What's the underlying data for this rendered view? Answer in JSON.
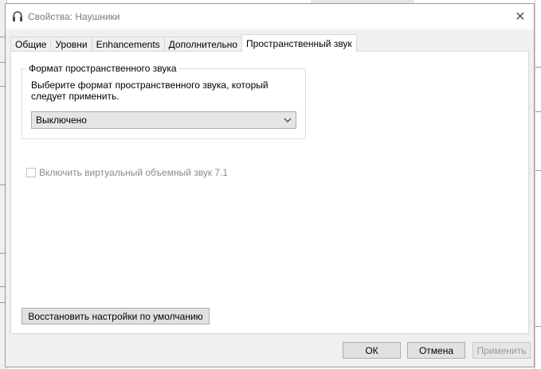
{
  "window": {
    "title": "Свойства: Наушники",
    "icon": "headphones-icon",
    "close_icon": "close-icon",
    "close_glyph": "✕"
  },
  "tabs": [
    {
      "label": "Общие"
    },
    {
      "label": "Уровни"
    },
    {
      "label": "Enhancements"
    },
    {
      "label": "Дополнительно"
    },
    {
      "label": "Пространственный звук",
      "selected": true
    }
  ],
  "spatial": {
    "group_title": "Формат пространственного звука",
    "description": "Выберите формат пространственного звука, который следует применить.",
    "format_value": "Выключено",
    "virtual_surround_label": "Включить виртуальный объемный звук 7.1",
    "virtual_surround_checked": false,
    "virtual_surround_enabled": false
  },
  "buttons": {
    "restore_defaults": "Восстановить настройки по умолчанию",
    "ok": "ОК",
    "cancel": "Отмена",
    "apply": "Применить"
  },
  "colors": {
    "dialog_bg": "#f0f0f0",
    "panel_bg": "#ffffff",
    "disabled_text": "#8a8a8a"
  }
}
